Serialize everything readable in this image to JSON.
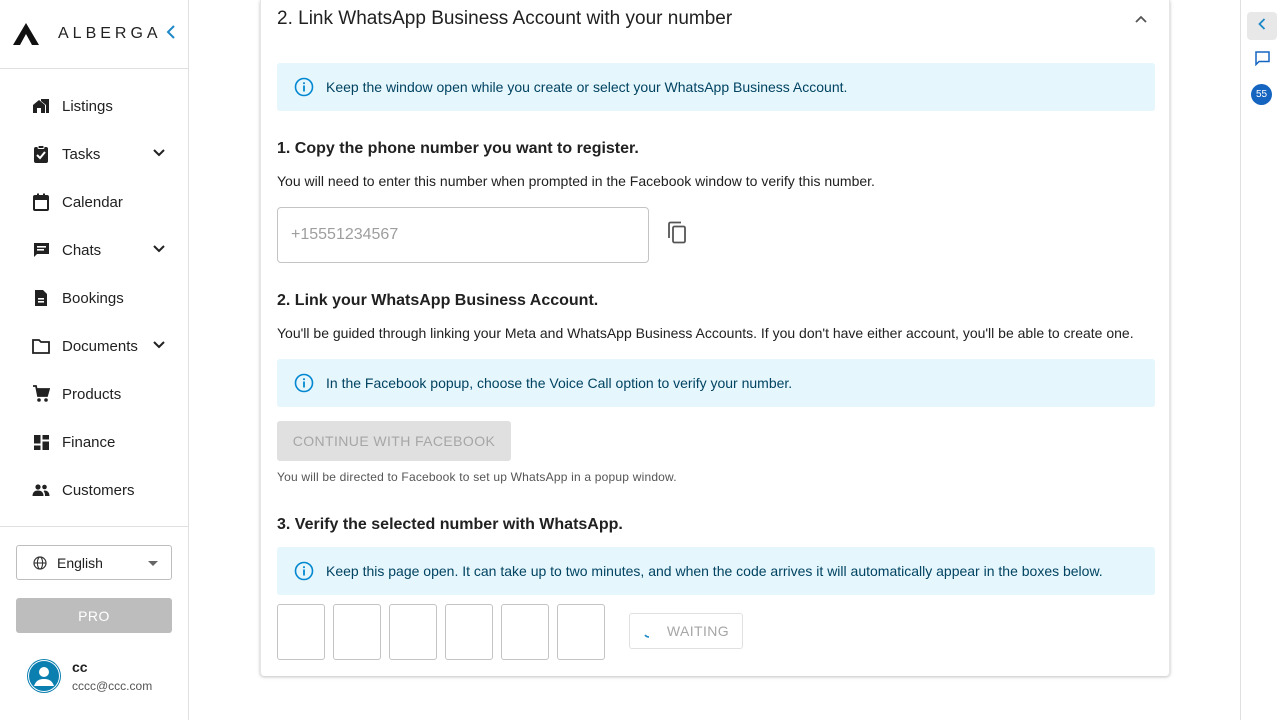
{
  "brand": {
    "name": "ALBERGA",
    "logo_icon": "alberga-logo-icon",
    "collapse_icon": "chevron-left-icon",
    "accent_color": "#1e88c8"
  },
  "sidebar": {
    "items": [
      {
        "label": "Listings",
        "icon": "house-icon",
        "expandable": false
      },
      {
        "label": "Tasks",
        "icon": "clipboard-check-icon",
        "expandable": true
      },
      {
        "label": "Calendar",
        "icon": "calendar-icon",
        "expandable": false
      },
      {
        "label": "Chats",
        "icon": "chat-icon",
        "expandable": true
      },
      {
        "label": "Bookings",
        "icon": "document-icon",
        "expandable": false
      },
      {
        "label": "Documents",
        "icon": "folder-icon",
        "expandable": true
      },
      {
        "label": "Products",
        "icon": "cart-icon",
        "expandable": false
      },
      {
        "label": "Finance",
        "icon": "dashboard-icon",
        "expandable": false
      },
      {
        "label": "Customers",
        "icon": "people-icon",
        "expandable": false
      }
    ],
    "language": {
      "value": "English",
      "icon": "globe-icon"
    },
    "pro_label": "PRO",
    "user": {
      "name": "cc",
      "email": "cccc@ccc.com"
    }
  },
  "card": {
    "title": "2. Link WhatsApp Business Account with your number",
    "alert_top": "Keep the window open while you create or select your WhatsApp Business Account.",
    "step1": {
      "title": "1. Copy the phone number you want to register.",
      "desc": "You will need to enter this number when prompted in the Facebook window to verify this number.",
      "phone_placeholder": "+15551234567"
    },
    "step2": {
      "title": "2. Link your WhatsApp Business Account.",
      "desc": "You'll be guided through linking your Meta and WhatsApp Business Accounts. If you don't have either account, you'll be able to create one.",
      "alert": "In the Facebook popup, choose the Voice Call option to verify your number.",
      "button": "CONTINUE WITH FACEBOOK",
      "note": "You will be directed to Facebook to set up WhatsApp in a popup window."
    },
    "step3": {
      "title": "3. Verify the selected number with WhatsApp.",
      "alert": "Keep this page open. It can take up to two minutes, and when the code arrives it will automatically appear in the boxes below.",
      "waiting_label": "WAITING"
    },
    "alert_color": "#e5f6fd",
    "info_color": "#0288d1"
  },
  "rail": {
    "badge_count": "55",
    "badge_color": "#1565c0"
  }
}
